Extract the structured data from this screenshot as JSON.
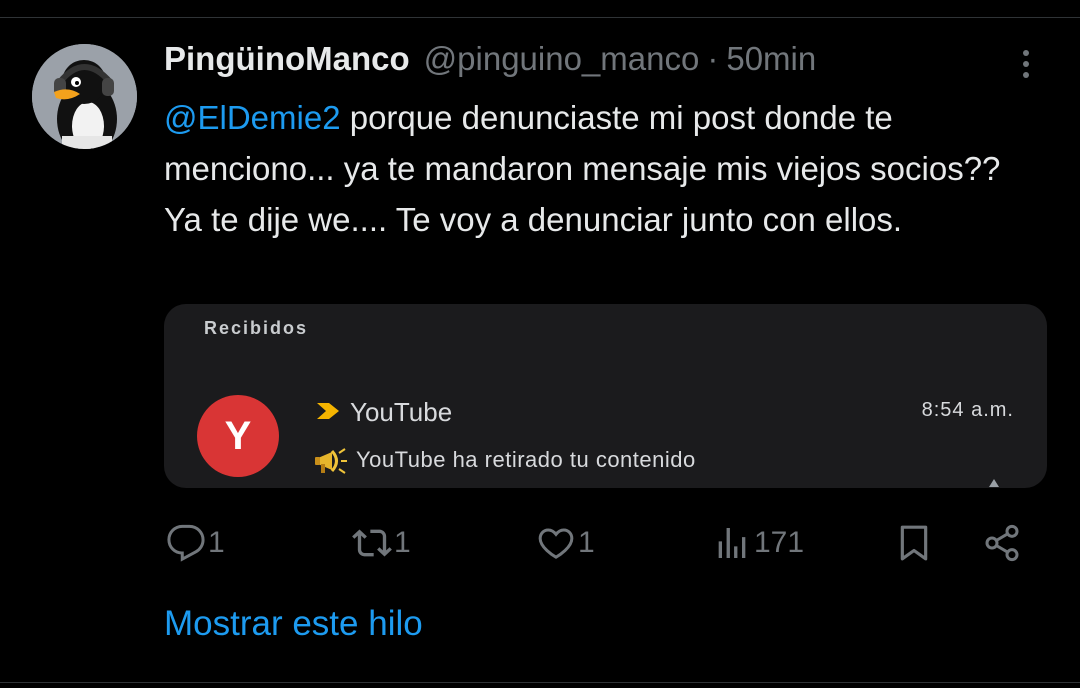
{
  "tweet": {
    "display_name": "PingüinoManco",
    "handle": "@pinguino_manco",
    "separator": "·",
    "time": "50min",
    "mention": "@ElDemie2",
    "text": " porque denunciaste mi post donde te menciono... ya te mandaron mensaje mis viejos socios?? Ya te dije we.... Te voy a denunciar junto con ellos."
  },
  "media": {
    "inbox_title": "Recibidos",
    "sender_initial": "Y",
    "sender_name": "YouTube",
    "time": "8:54 a.m.",
    "subject": "YouTube ha retirado tu contenido",
    "colors": {
      "avatar": "#d93535",
      "label": "#f5b400",
      "background": "#1b1b1d"
    }
  },
  "actions": {
    "replies": "1",
    "reposts": "1",
    "likes": "1",
    "views": "171"
  },
  "icons": [
    "more-icon",
    "reply-icon",
    "repost-icon",
    "like-icon",
    "views-icon",
    "bookmark-icon",
    "share-icon",
    "megaphone-icon",
    "label-chevron-icon"
  ],
  "show_thread": "Mostrar este hilo",
  "colors": {
    "accent": "#1d9bf0",
    "secondary_text": "#71767b",
    "text": "#e7e9ea"
  }
}
